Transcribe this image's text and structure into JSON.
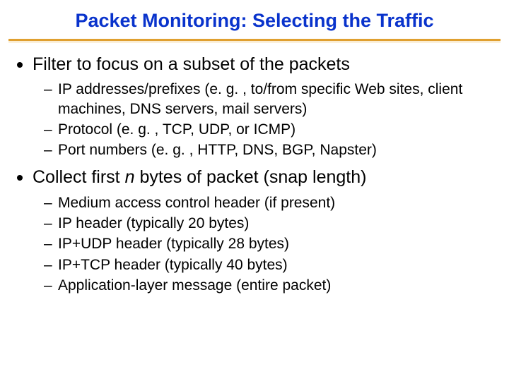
{
  "title": "Packet Monitoring: Selecting the Traffic",
  "sections": [
    {
      "heading_pre": "Filter to focus on a subset of the packets",
      "heading_ital": "",
      "heading_post": "",
      "items": [
        "IP addresses/prefixes (e. g. , to/from specific Web sites, client machines, DNS servers, mail servers)",
        "Protocol (e. g. , TCP, UDP, or ICMP)",
        "Port numbers (e. g. , HTTP, DNS, BGP, Napster)"
      ]
    },
    {
      "heading_pre": "Collect first ",
      "heading_ital": "n",
      "heading_post": " bytes of packet (snap length)",
      "items": [
        "Medium access control header (if present)",
        "IP header (typically 20 bytes)",
        "IP+UDP header (typically 28 bytes)",
        "IP+TCP header (typically 40 bytes)",
        "Application-layer message (entire packet)"
      ]
    }
  ]
}
